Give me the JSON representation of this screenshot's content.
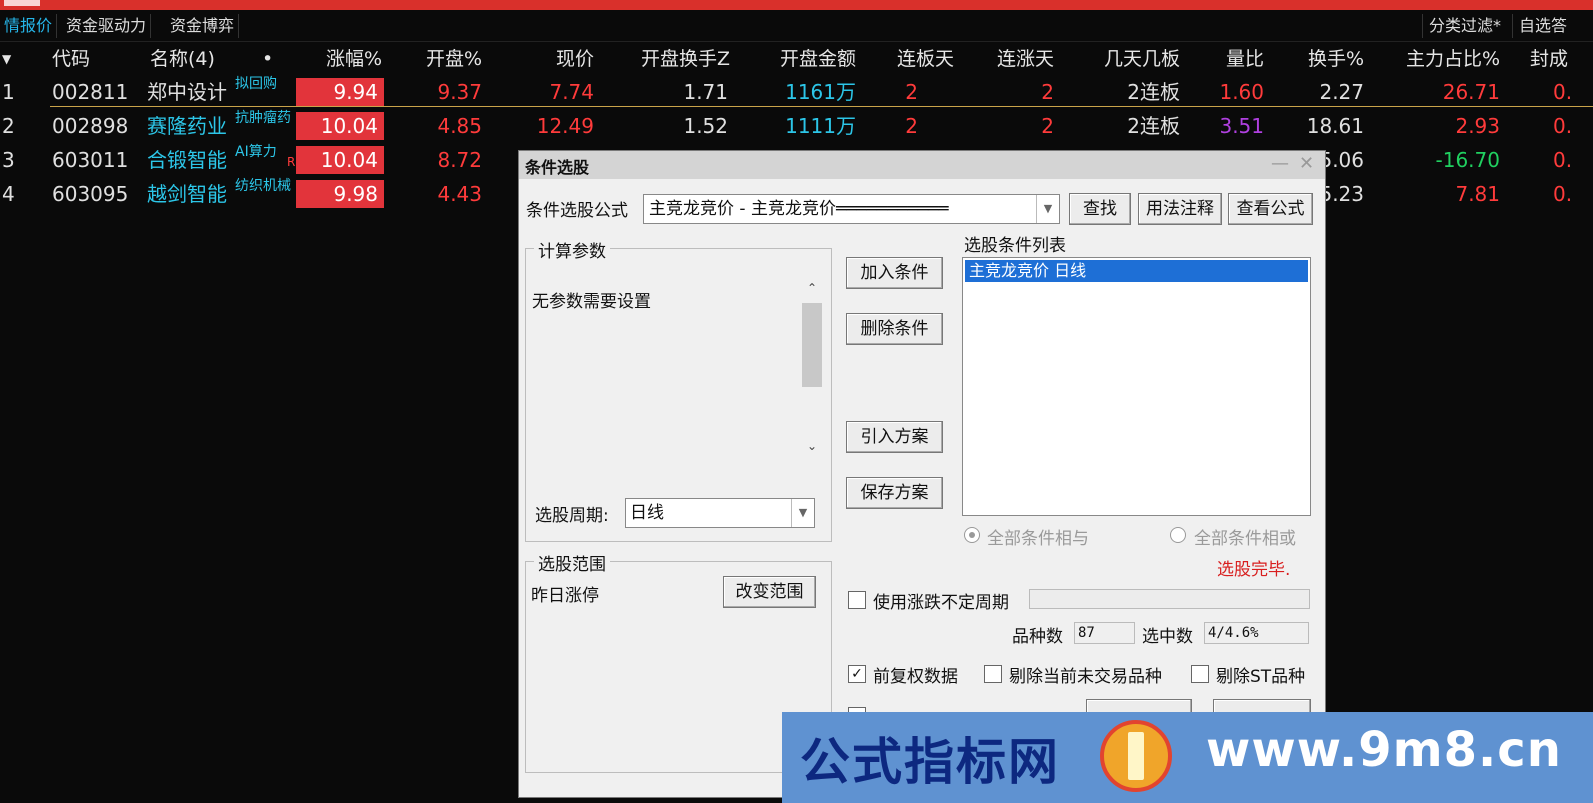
{
  "tabs": [
    "情报价",
    "资金驱动力",
    "资金博弈"
  ],
  "right_tabs": [
    "分类过滤*",
    "自选答"
  ],
  "columns": [
    "代码",
    "名称(4)",
    "•",
    "涨幅%",
    "开盘%",
    "现价",
    "开盘换手Z",
    "开盘金额",
    "连板天",
    "连涨天",
    "几天几板",
    "量比",
    "换手%",
    "主力占比%",
    "封成"
  ],
  "rows": [
    {
      "idx": "1",
      "code": "002811",
      "name": "郑中设计",
      "tag": "拟回购",
      "chg": "9.94",
      "open": "9.37",
      "price": "7.74",
      "turn_z": "1.71",
      "amount": "1161万",
      "lb": "2",
      "lz": "2",
      "jtjb": "2连板",
      "lbr": "1.60",
      "hs": "2.27",
      "zl": "26.71",
      "fc": "0."
    },
    {
      "idx": "2",
      "code": "002898",
      "name": "赛隆药业",
      "tag": "抗肿瘤药",
      "chg": "10.04",
      "open": "4.85",
      "price": "12.49",
      "turn_z": "1.52",
      "amount": "1111万",
      "lb": "2",
      "lz": "2",
      "jtjb": "2连板",
      "lbr": "3.51",
      "hs": "18.61",
      "zl": "2.93",
      "fc": "0."
    },
    {
      "idx": "3",
      "code": "603011",
      "name": "合锻智能",
      "tag": "AI算力",
      "tag2": "R",
      "chg": "10.04",
      "open": "8.72",
      "hs": "5.06",
      "zl": "-16.70",
      "fc": "0."
    },
    {
      "idx": "4",
      "code": "603095",
      "name": "越剑智能",
      "tag": "纺织机械",
      "chg": "9.98",
      "open": "4.43",
      "hs": "5.23",
      "zl": "7.81",
      "fc": "0."
    }
  ],
  "dialog": {
    "title": "条件选股",
    "formula_label": "条件选股公式",
    "formula_value": "主竞龙竞价  -  主竞龙竞价═══════════",
    "btn_find": "查找",
    "btn_usage": "用法注释",
    "btn_view": "查看公式",
    "params_title": "计算参数",
    "params_text": "无参数需要设置",
    "period_label": "选股周期:",
    "period_value": "日线",
    "btn_add": "加入条件",
    "btn_delete": "删除条件",
    "btn_import": "引入方案",
    "btn_save": "保存方案",
    "cond_list_title": "选股条件列表",
    "cond_list": [
      "主竞龙竞价  日线"
    ],
    "radio_and": "全部条件相与",
    "radio_or": "全部条件相或",
    "status": "选股完毕.",
    "range_title": "选股范围",
    "range_value": "昨日涨停",
    "btn_range": "改变范围",
    "chk_variable_period": "使用涨跌不定周期",
    "count_label": "品种数",
    "count_value": "87",
    "selected_label": "选中数",
    "selected_value": "4/4.6%",
    "chk_adjust": "前复权数据",
    "chk_exclude_untraded": "剔除当前未交易品种",
    "chk_exclude_st": "剔除ST品种"
  },
  "watermark": {
    "brand": "公式指标网",
    "url": "www.9m8.cn"
  }
}
